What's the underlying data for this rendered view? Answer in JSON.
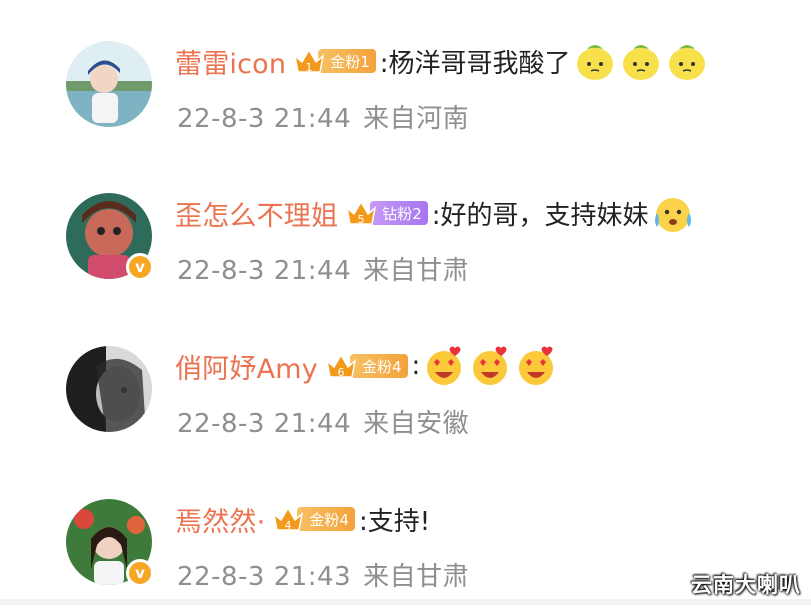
{
  "comments": [
    {
      "username": "蕾雷icon",
      "badge": {
        "kind": "gold",
        "level": "1",
        "label": "金粉1"
      },
      "text": ":杨洋哥哥我酸了",
      "emojis": [
        "lemon-emoji",
        "lemon-emoji",
        "lemon-emoji"
      ],
      "time": "22-8-3 21:44",
      "location": "来自河南",
      "verified": false
    },
    {
      "username": "歪怎么不理姐",
      "badge": {
        "kind": "diamond",
        "level": "5",
        "label": "钻粉2"
      },
      "text": ":好的哥，支持妹妹",
      "emojis": [
        "crying-emoji"
      ],
      "time": "22-8-3 21:44",
      "location": "来自甘肃",
      "verified": true,
      "verified_mark": "v"
    },
    {
      "username": "俏阿妤Amy",
      "badge": {
        "kind": "gold",
        "level": "6",
        "label": "金粉4"
      },
      "text": ":",
      "emojis": [
        "heart-eyes-emoji",
        "heart-eyes-emoji",
        "heart-eyes-emoji"
      ],
      "time": "22-8-3 21:44",
      "location": "来自安徽",
      "verified": false
    },
    {
      "username": "焉然然·",
      "badge": {
        "kind": "gold",
        "level": "4",
        "label": "金粉4"
      },
      "text": ":支持!",
      "emojis": [],
      "time": "22-8-3 21:43",
      "location": "来自甘肃",
      "verified": true,
      "verified_mark": "v"
    }
  ],
  "watermark": "云南大喇叭",
  "colors": {
    "username": "#eb7350",
    "meta": "#8f8f8f",
    "gold_badge": "#f3a23b",
    "diamond_badge": "#a775ef",
    "verified": "#f6a623"
  }
}
